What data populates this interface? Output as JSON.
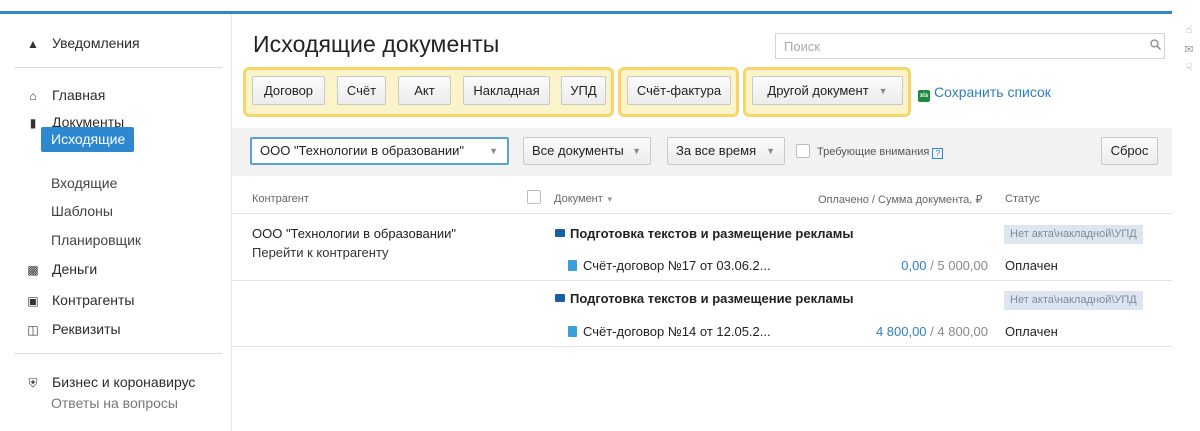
{
  "sidebar": {
    "notifications": "Уведомления",
    "home": "Главная",
    "documents": "Документы",
    "outgoing": "Исходящие",
    "incoming": "Входящие",
    "templates": "Шаблоны",
    "planner": "Планировщик",
    "money": "Деньги",
    "contractors": "Контрагенты",
    "requisites": "Реквизиты",
    "business_covid": "Бизнес и коронавирус",
    "faq": "Ответы на вопросы"
  },
  "header": {
    "title": "Исходящие документы",
    "search_placeholder": "Поиск"
  },
  "toolbar": {
    "contract": "Договор",
    "invoice": "Счёт",
    "act": "Акт",
    "waybill": "Накладная",
    "upd": "УПД",
    "invoice_factura": "Счёт-фактура",
    "other_document": "Другой документ",
    "save_list": "Сохранить список",
    "xls": "xls"
  },
  "filters": {
    "company": "ООО \"Технологии в образовании\"",
    "doc_type": "Все документы",
    "period": "За все время",
    "attention": "Требующие внимания",
    "attention_help": "?",
    "reset": "Сброс"
  },
  "table": {
    "headers": {
      "contractor": "Контрагент",
      "document": "Документ",
      "paid": "Оплачено / Сумма документа, ₽",
      "status": "Статус"
    },
    "rows": [
      {
        "contractor": "ООО \"Технологии в образовании\"",
        "contractor_link": "Перейти к контрагенту",
        "doc_title": "Подготовка текстов и размещение рекламы",
        "status_badge": "Нет акта\\накладной\\УПД",
        "sub_doc": "Счёт-договор №17 от 03.06.2...",
        "paid": "0,00",
        "total": " / 5 000,00",
        "status": "Оплачен"
      },
      {
        "contractor": "",
        "contractor_link": "",
        "doc_title": "Подготовка текстов и размещение рекламы",
        "status_badge": "Нет акта\\накладной\\УПД",
        "sub_doc": "Счёт-договор №14 от 12.05.2...",
        "paid": "4 800,00",
        "total": " / 4 800,00",
        "status": "Оплачен"
      }
    ]
  },
  "icons": {
    "accent": "#2d88d0",
    "highlight": "#f6d66a"
  }
}
